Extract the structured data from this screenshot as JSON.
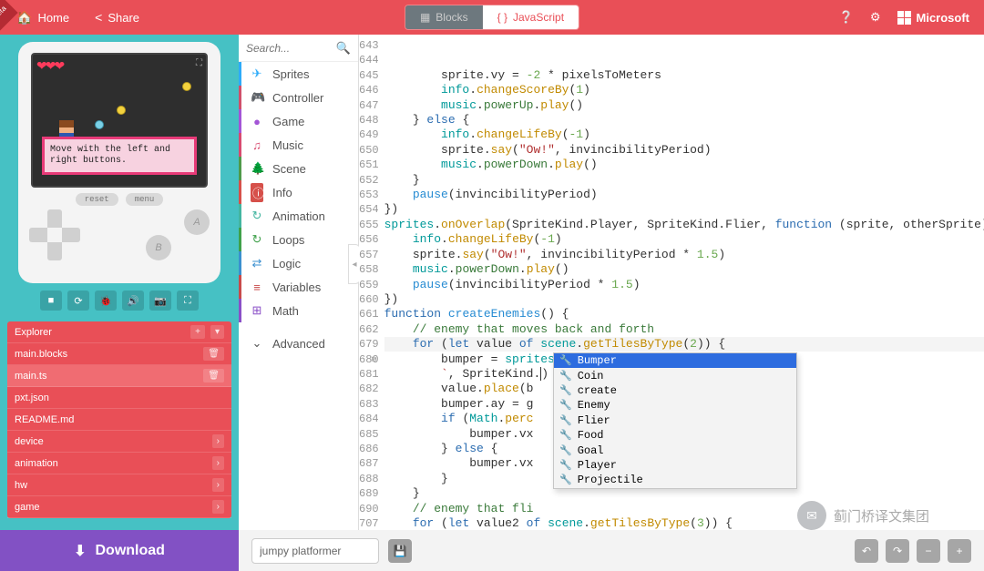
{
  "beta_label": "Beta",
  "topbar": {
    "home": "Home",
    "share": "Share",
    "blocks_label": "Blocks",
    "js_label": "JavaScript",
    "microsoft": "Microsoft"
  },
  "simulator": {
    "reset": "reset",
    "menu": "menu",
    "btn_a": "A",
    "btn_b": "B",
    "message": "Move with the left and right buttons.",
    "tool_icons": [
      "stop",
      "refresh",
      "debug",
      "sound",
      "camera",
      "fullscreen"
    ]
  },
  "explorer": {
    "title": "Explorer",
    "items": [
      {
        "name": "main.blocks",
        "del": true
      },
      {
        "name": "main.ts",
        "del": true,
        "active": true
      },
      {
        "name": "pxt.json"
      },
      {
        "name": "README.md"
      },
      {
        "name": "device",
        "expand": true
      },
      {
        "name": "animation",
        "expand": true
      },
      {
        "name": "hw",
        "expand": true
      },
      {
        "name": "game",
        "expand": true
      }
    ]
  },
  "categories": {
    "search_placeholder": "Search...",
    "items": [
      {
        "label": "Sprites",
        "color": "#2dabf9",
        "icon": "✈"
      },
      {
        "label": "Controller",
        "color": "#d04f6a",
        "icon": "🎮"
      },
      {
        "label": "Game",
        "color": "#a355d6",
        "icon": "●"
      },
      {
        "label": "Music",
        "color": "#d84a6f",
        "icon": "♫"
      },
      {
        "label": "Scene",
        "color": "#4f9a4a",
        "icon": "🌲"
      },
      {
        "label": "Info",
        "color": "#d6504a",
        "icon": "ⓘ",
        "filled": true
      },
      {
        "label": "Animation",
        "color": "#43b5a0",
        "icon": "↻"
      },
      {
        "label": "Loops",
        "color": "#3fa04a",
        "icon": "↻"
      },
      {
        "label": "Logic",
        "color": "#3a8fcf",
        "icon": "⇄"
      },
      {
        "label": "Variables",
        "color": "#c84a4a",
        "icon": "≡"
      },
      {
        "label": "Math",
        "color": "#8a4fc7",
        "icon": "⊞"
      }
    ],
    "advanced": "Advanced"
  },
  "editor": {
    "line_numbers": [
      643,
      644,
      645,
      646,
      647,
      648,
      649,
      650,
      651,
      652,
      653,
      654,
      655,
      656,
      657,
      658,
      659,
      660,
      661,
      662,
      679,
      680,
      681,
      682,
      683,
      684,
      685,
      686,
      687,
      688,
      689,
      690,
      707
    ]
  },
  "suggest": {
    "items": [
      "Bumper",
      "Coin",
      "create",
      "Enemy",
      "Flier",
      "Food",
      "Goal",
      "Player",
      "Projectile"
    ],
    "selected": "Bumper"
  },
  "download_label": "Download",
  "project_name": "jumpy platformer",
  "watermark": "蓟门桥译文集团"
}
